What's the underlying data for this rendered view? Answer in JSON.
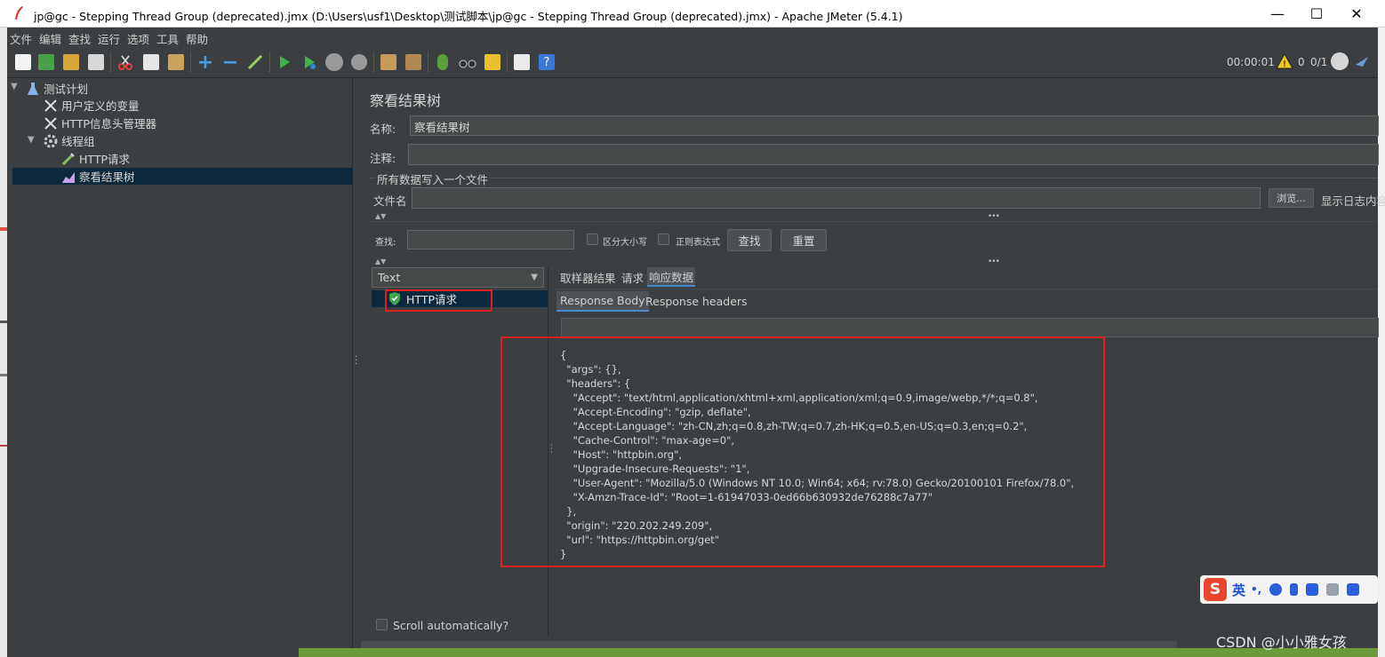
{
  "window": {
    "title": "jp@gc - Stepping Thread Group (deprecated).jmx (D:\\Users\\usf1\\Desktop\\测试脚本\\jp@gc - Stepping Thread Group (deprecated).jmx) - Apache JMeter (5.4.1)",
    "minimize": "—",
    "maximize": "☐",
    "close": "✕"
  },
  "menu": [
    "文件",
    "编辑",
    "查找",
    "运行",
    "选项",
    "工具",
    "帮助"
  ],
  "toolbar": {
    "timer": "00:00:01",
    "warnings": "0",
    "threads": "0/1"
  },
  "tree": {
    "items": [
      {
        "label": "测试计划",
        "icon": "flask-icon"
      },
      {
        "label": "用户定义的变量",
        "icon": "wrench-icon"
      },
      {
        "label": "HTTP信息头管理器",
        "icon": "wrench-icon"
      },
      {
        "label": "线程组",
        "icon": "gear-icon"
      },
      {
        "label": "HTTP请求",
        "icon": "pipette-icon"
      },
      {
        "label": "察看结果树",
        "icon": "chart-icon"
      }
    ]
  },
  "panel": {
    "title": "察看结果树",
    "name_label": "名称:",
    "name_value": "察看结果树",
    "comment_label": "注释:",
    "comment_value": "",
    "file_section": "所有数据写入一个文件",
    "filename_label": "文件名",
    "filename_value": "",
    "browse": "浏览...",
    "log_display": "显示日志内容",
    "search_label": "查找:",
    "search_value": "",
    "case_sensitive": "区分大小写",
    "regex": "正则表达式",
    "find_button": "查找",
    "reset_button": "重置",
    "renderer": "Text",
    "result_item": "HTTP请求",
    "tabs": [
      "取样器结果",
      "请求",
      "响应数据"
    ],
    "subtabs": [
      "Response Body",
      "Response headers"
    ],
    "response_body": "{\n  \"args\": {}, \n  \"headers\": {\n    \"Accept\": \"text/html,application/xhtml+xml,application/xml;q=0.9,image/webp,*/*;q=0.8\", \n    \"Accept-Encoding\": \"gzip, deflate\", \n    \"Accept-Language\": \"zh-CN,zh;q=0.8,zh-TW;q=0.7,zh-HK;q=0.5,en-US;q=0.3,en;q=0.2\", \n    \"Cache-Control\": \"max-age=0\", \n    \"Host\": \"httpbin.org\", \n    \"Upgrade-Insecure-Requests\": \"1\", \n    \"User-Agent\": \"Mozilla/5.0 (Windows NT 10.0; Win64; x64; rv:78.0) Gecko/20100101 Firefox/78.0\", \n    \"X-Amzn-Trace-Id\": \"Root=1-61947033-0ed66b630932de76288c7a77\"\n  }, \n  \"origin\": \"220.202.249.209\", \n  \"url\": \"https://httpbin.org/get\"\n}",
    "scroll_auto": "Scroll automatically?"
  },
  "ime": {
    "logo": "S",
    "mode": "英",
    "punct": "•,"
  },
  "watermark": "CSDN @小小雅女孩",
  "colors": {
    "background": "#3c3f41",
    "selection": "#0d293e",
    "highlight": "#e02020",
    "accent": "#4a88c7"
  }
}
